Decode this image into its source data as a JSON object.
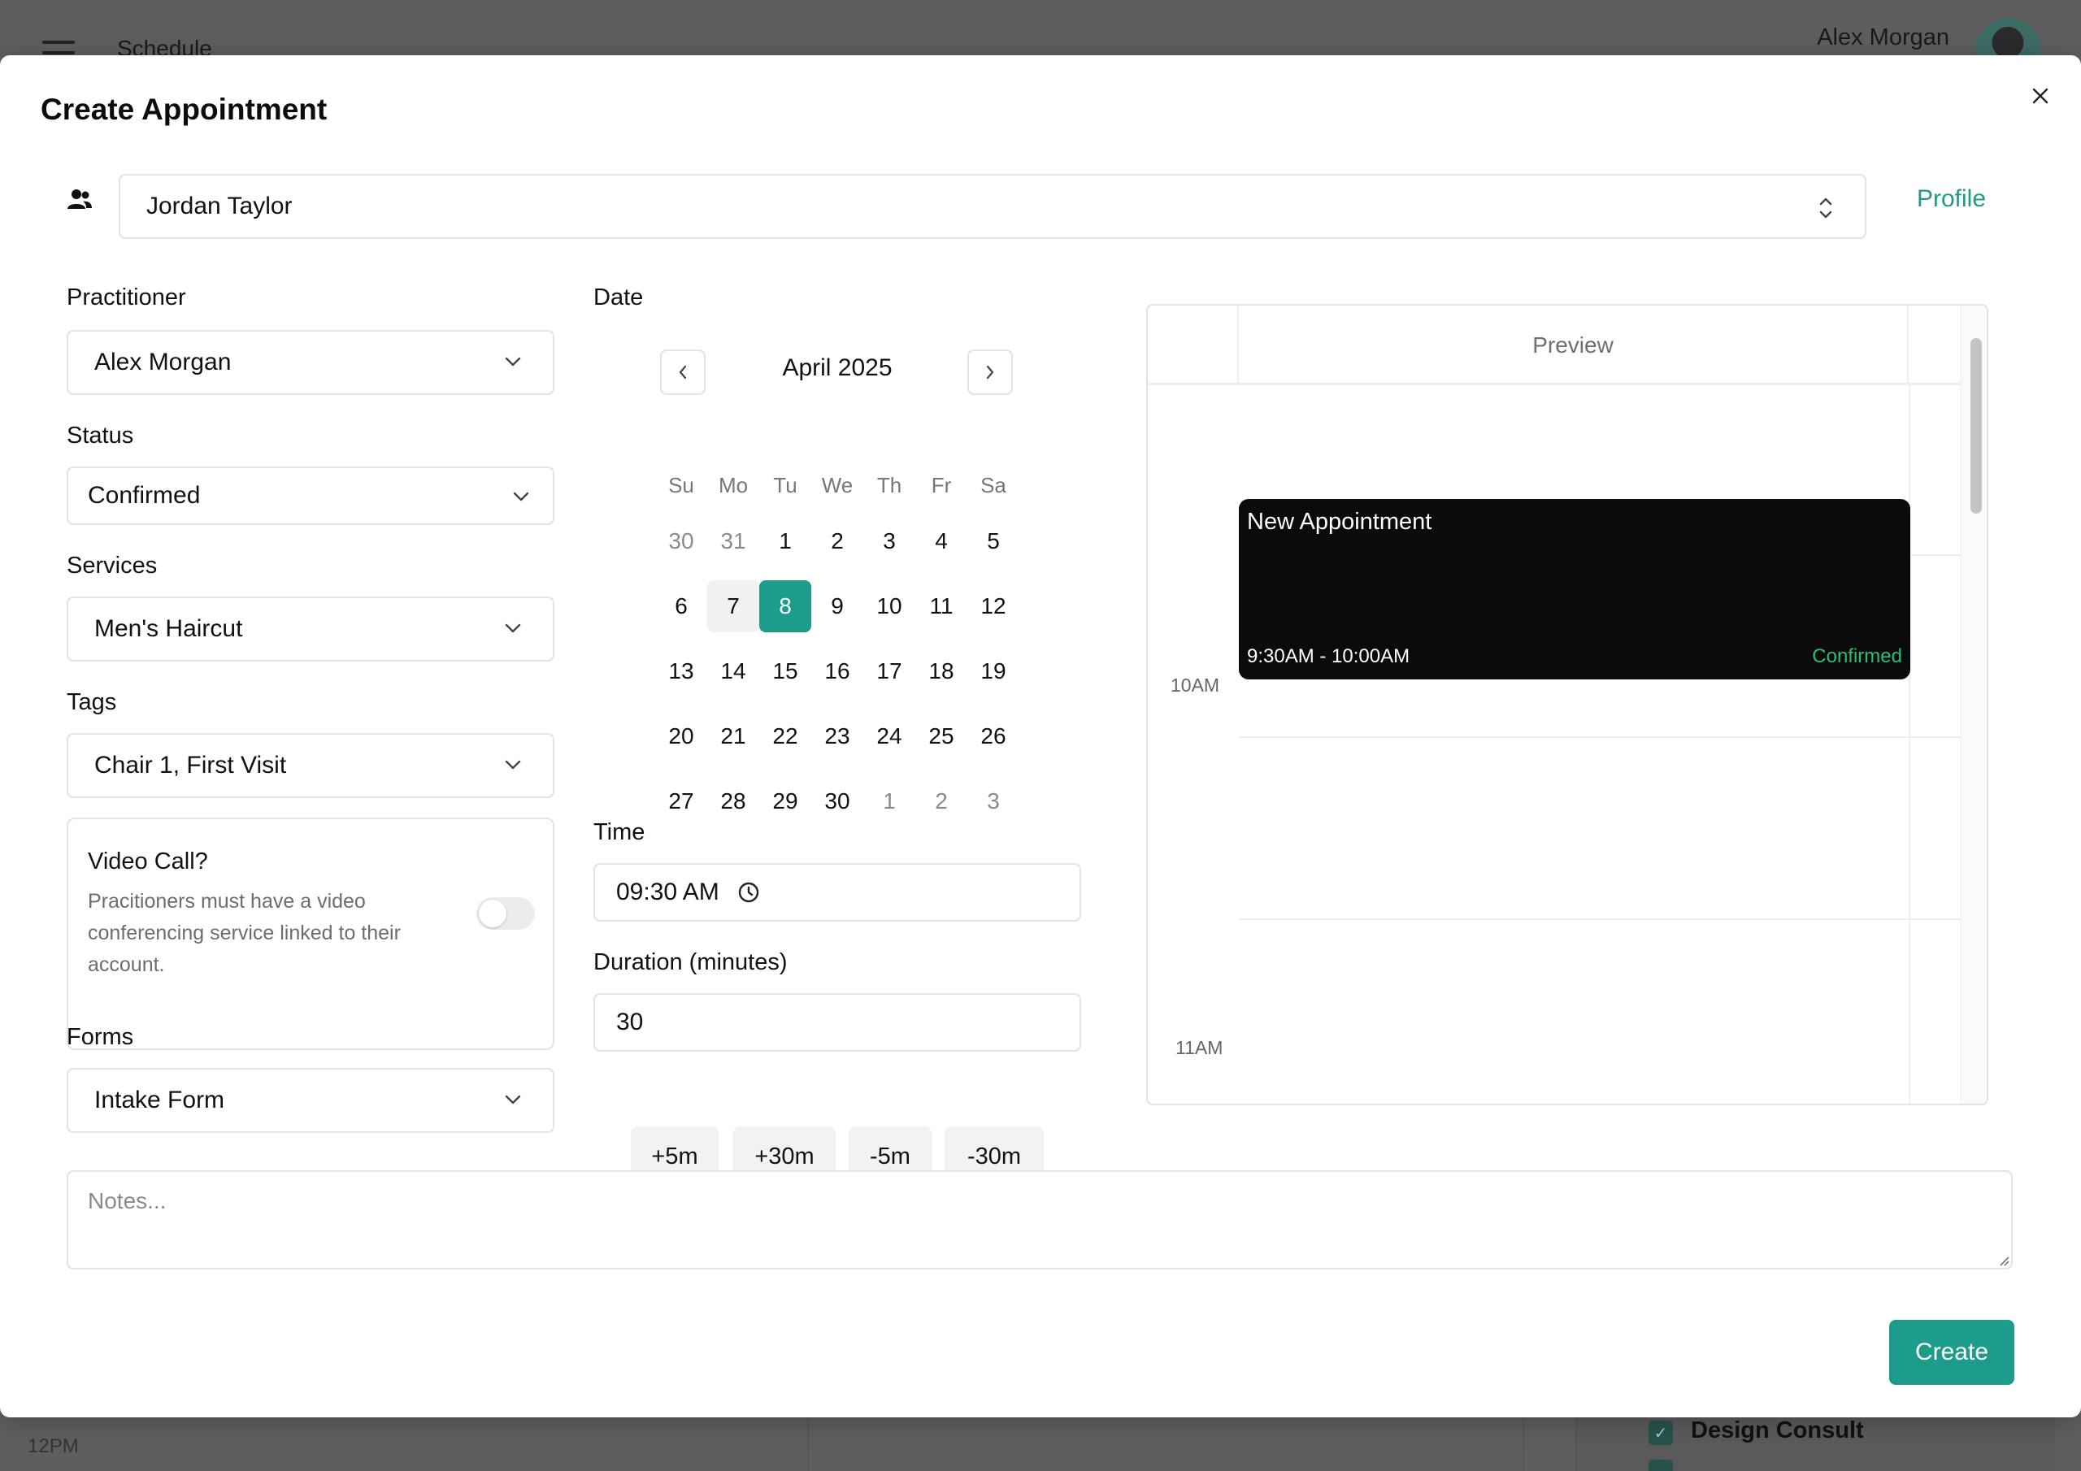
{
  "background": {
    "title": "Schedule",
    "user_name": "Alex Morgan",
    "time_label": "12PM",
    "filter_items": [
      "Design Consult"
    ]
  },
  "modal": {
    "title": "Create Appointment",
    "client": {
      "value": "Jordan Taylor",
      "profile_label": "Profile"
    },
    "practitioner": {
      "label": "Practitioner",
      "value": "Alex Morgan"
    },
    "status": {
      "label": "Status",
      "value": "Confirmed"
    },
    "services": {
      "label": "Services",
      "value": "Men's Haircut"
    },
    "tags": {
      "label": "Tags",
      "value": "Chair 1, First Visit"
    },
    "video_call": {
      "title": "Video Call?",
      "description": "Pracitioners must have a video conferencing service linked to their account.",
      "enabled": false
    },
    "forms": {
      "label": "Forms",
      "value": "Intake Form"
    },
    "date": {
      "label": "Date",
      "month": "April 2025",
      "weekdays": [
        "Su",
        "Mo",
        "Tu",
        "We",
        "Th",
        "Fr",
        "Sa"
      ],
      "weeks": [
        [
          "30",
          "31",
          "1",
          "2",
          "3",
          "4",
          "5"
        ],
        [
          "6",
          "7",
          "8",
          "9",
          "10",
          "11",
          "12"
        ],
        [
          "13",
          "14",
          "15",
          "16",
          "17",
          "18",
          "19"
        ],
        [
          "20",
          "21",
          "22",
          "23",
          "24",
          "25",
          "26"
        ],
        [
          "27",
          "28",
          "29",
          "30",
          "1",
          "2",
          "3"
        ]
      ],
      "selected": "8",
      "today": "7"
    },
    "time": {
      "label": "Time",
      "value": "09:30 AM"
    },
    "duration": {
      "label": "Duration (minutes)",
      "value": "30",
      "chips": [
        "+5m",
        "+30m",
        "-5m",
        "-30m"
      ]
    },
    "preview": {
      "title": "Preview",
      "hours": [
        "10AM",
        "11AM"
      ],
      "appointment": {
        "title": "New Appointment",
        "time": "9:30AM - 10:00AM",
        "status": "Confirmed"
      }
    },
    "notes": {
      "placeholder": "Notes..."
    },
    "create_label": "Create"
  },
  "colors": {
    "accent": "#1e9c8b",
    "confirmed": "#2bbf75",
    "appointment_bg": "#0b0b0d"
  }
}
